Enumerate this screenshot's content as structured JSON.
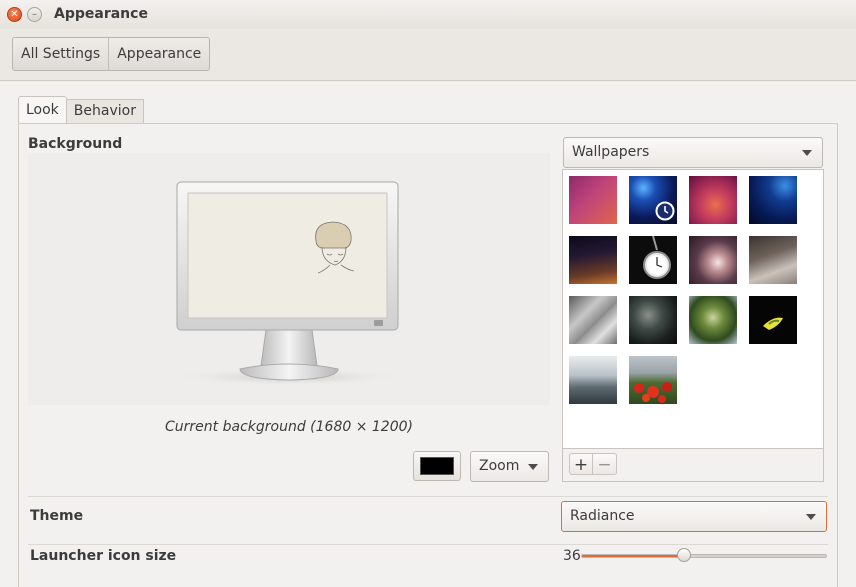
{
  "window": {
    "title": "Appearance"
  },
  "breadcrumb": [
    "All Settings",
    "Appearance"
  ],
  "tabs": [
    {
      "label": "Look",
      "active": true
    },
    {
      "label": "Behavior",
      "active": false
    }
  ],
  "background": {
    "heading": "Background",
    "caption": "Current background (1680 × 1200)",
    "color": "#000000",
    "scaling": "Zoom"
  },
  "wallpapers": {
    "source": "Wallpapers",
    "thumbnails": [
      "purple-orange-gradient",
      "blue-planet-clock",
      "pink-orange-planet",
      "blue-planet",
      "starry-night-sky",
      "pocket-watch",
      "crystal-bokeh",
      "frosted-grass",
      "ice-crystals",
      "dark-foliage",
      "dragonfly-leaf",
      "yellow-flower-dark",
      "misty-hills",
      "red-poppies-field"
    ],
    "add_label": "+",
    "remove_label": "−"
  },
  "theme": {
    "label": "Theme",
    "value": "Radiance"
  },
  "launcher": {
    "label": "Launcher icon size",
    "value": "36",
    "level": 0.42
  },
  "colors": {
    "accent": "#dd6b3c",
    "close": "#df4a16"
  }
}
